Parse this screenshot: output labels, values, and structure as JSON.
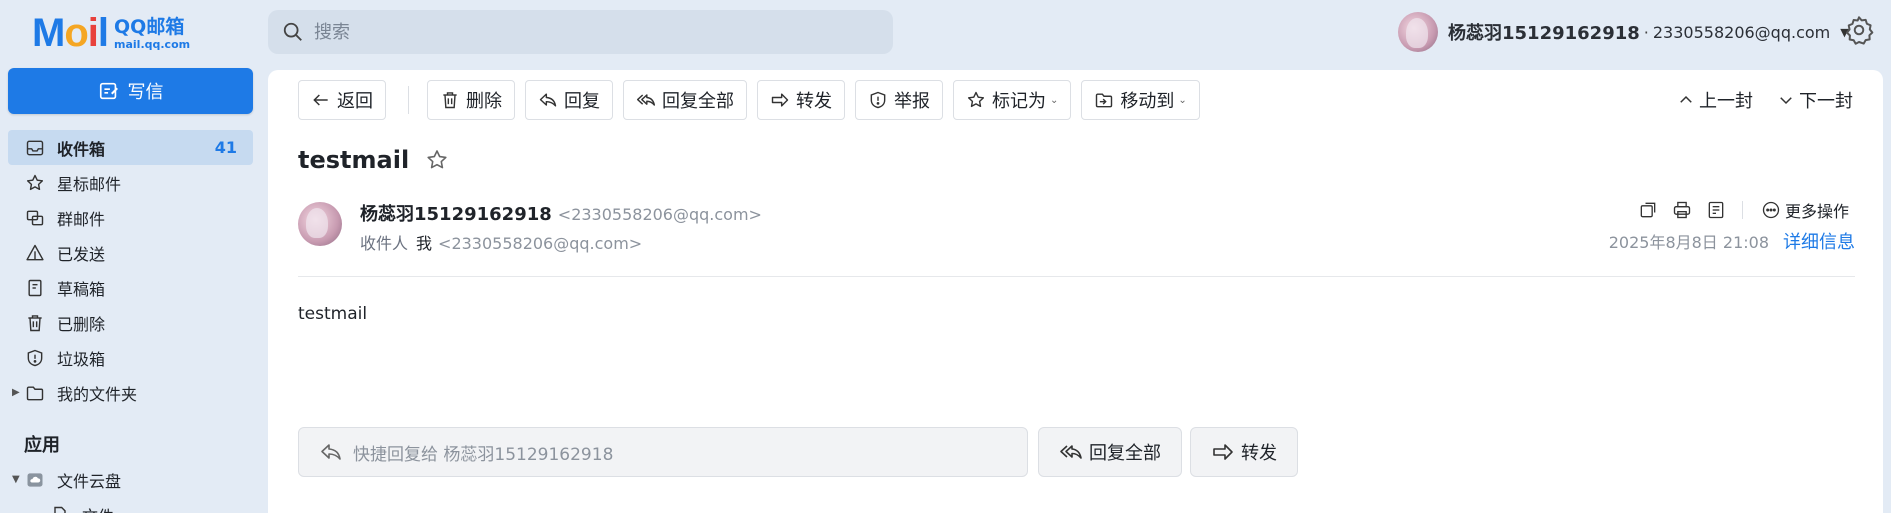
{
  "logo": {
    "mark": "MOil",
    "name": "QQ邮箱",
    "domain": "mail.qq.com"
  },
  "search": {
    "placeholder": "搜索"
  },
  "account": {
    "name": "杨蕊羽15129162918",
    "separator": "·",
    "email": "2330558206@qq.com"
  },
  "compose": {
    "label": "写信"
  },
  "sidebar": {
    "items": [
      {
        "label": "收件箱",
        "count": "41",
        "icon": "inbox-icon"
      },
      {
        "label": "星标邮件",
        "icon": "star-icon"
      },
      {
        "label": "群邮件",
        "icon": "group-mail-icon"
      },
      {
        "label": "已发送",
        "icon": "sent-icon"
      },
      {
        "label": "草稿箱",
        "icon": "draft-icon"
      },
      {
        "label": "已删除",
        "icon": "trash-icon"
      },
      {
        "label": "垃圾箱",
        "icon": "spam-shield-icon"
      },
      {
        "label": "我的文件夹",
        "icon": "folder-icon"
      }
    ],
    "apps_title": "应用",
    "cloud": {
      "label": "文件云盘",
      "child": "文件"
    }
  },
  "toolbar": {
    "back": "返回",
    "delete": "删除",
    "reply": "回复",
    "reply_all": "回复全部",
    "forward": "转发",
    "report": "举报",
    "mark_as": "标记为",
    "move_to": "移动到",
    "prev": "上一封",
    "next": "下一封"
  },
  "mail": {
    "subject": "testmail",
    "sender_name": "杨蕊羽15129162918",
    "sender_addr": "<2330558206@qq.com>",
    "to_label": "收件人",
    "to_name": "我",
    "to_addr": "<2330558206@qq.com>",
    "more_actions": "更多操作",
    "date": "2025年8月8日 21:08",
    "details": "详细信息",
    "body": "testmail"
  },
  "quick_reply": {
    "placeholder": "快捷回复给 杨蕊羽15129162918",
    "reply_all": "回复全部",
    "forward": "转发"
  },
  "colors": {
    "accent": "#1e7ae6",
    "sidebar_bg": "#e3ebf5",
    "active_item": "#c6daf0"
  }
}
